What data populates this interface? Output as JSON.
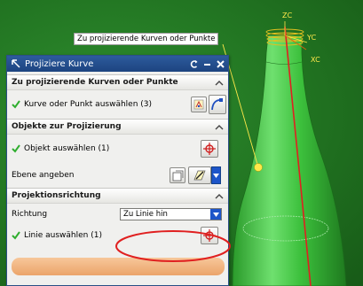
{
  "viewport": {
    "callout_text": "Zu projizierende Kurven oder Punkte",
    "axes": {
      "z": "ZC",
      "y": "YC",
      "x": "XC"
    }
  },
  "dialog": {
    "title": "Projiziere Kurve",
    "sections": {
      "curves": {
        "heading": "Zu projizierende Kurven oder Punkte",
        "select_label": "Kurve oder Punkt auswählen (3)"
      },
      "objects": {
        "heading": "Objekte zur Projizierung",
        "select_label": "Objekt auswählen (1)",
        "plane_label": "Ebene angeben"
      },
      "direction": {
        "heading": "Projektionsrichtung",
        "direction_label": "Richtung",
        "direction_value": "Zu Linie hin",
        "line_label": "Linie auswählen (1)"
      }
    }
  },
  "colors": {
    "titlebar": "#1d4480",
    "check": "#2fae2f",
    "highlight": "#eba46a",
    "annotation_ring": "#e02020",
    "bottle": "#2faa2f",
    "projection_line": "#e02020"
  }
}
